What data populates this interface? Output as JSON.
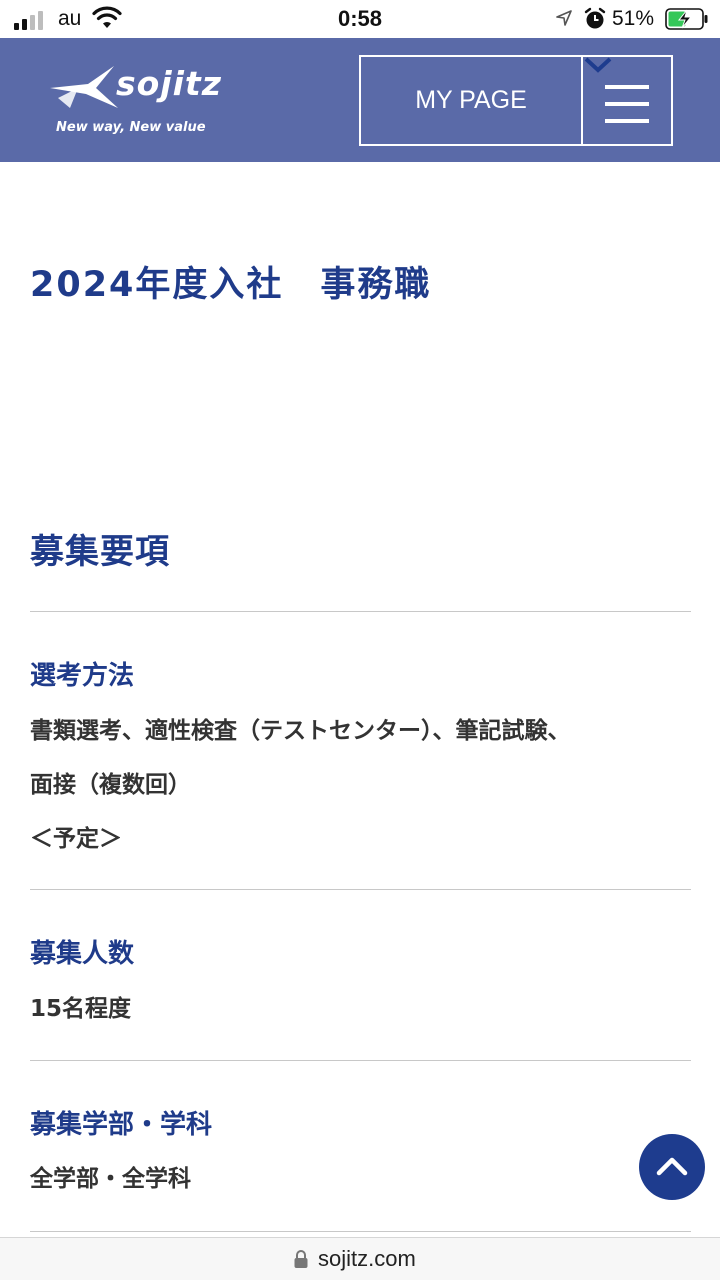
{
  "status_bar": {
    "carrier": "au",
    "time": "0:58",
    "battery_percent": "51%",
    "signal_bars_active": 2,
    "signal_bars_total": 4,
    "icons": [
      "signal-icon",
      "wifi-icon",
      "location-arrow-icon",
      "alarm-icon",
      "battery-charging-icon"
    ]
  },
  "header": {
    "logo_text": "sojitz",
    "logo_tagline": "New way, New value",
    "mypage_label": "MY PAGE",
    "menu_icon": "hamburger-menu-icon",
    "background_color": "#5a6aa8"
  },
  "main": {
    "page_title": "2024年度入社　事務職",
    "section_title": "募集要項",
    "items": [
      {
        "label": "選考方法",
        "lines": [
          "書類選考、適性検査（テストセンター）、筆記試験、",
          "面接（複数回）",
          "＜予定＞"
        ]
      },
      {
        "label": "募集人数",
        "lines": [
          "15名程度"
        ]
      },
      {
        "label": "募集学部・学科",
        "lines": [
          "全学部・全学科"
        ]
      }
    ]
  },
  "back_to_top_icon": "chevron-up-icon",
  "browser": {
    "url": "sojitz.com",
    "lock_icon": "lock-icon"
  },
  "colors": {
    "accent": "#1f3b8a",
    "header_bg": "#5a6aa8",
    "body_text": "#333333"
  }
}
